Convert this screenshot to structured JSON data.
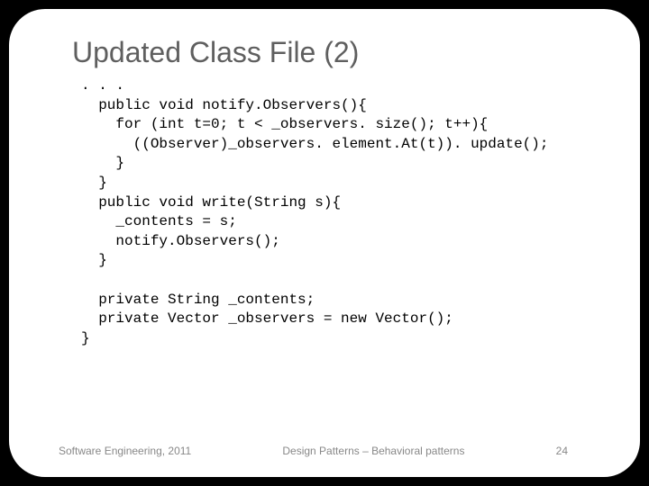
{
  "title": "Updated Class File (2)",
  "code": ". . .\n  public void notify.Observers(){\n    for (int t=0; t < _observers. size(); t++){\n      ((Observer)_observers. element.At(t)). update();\n    }\n  }\n  public void write(String s){\n    _contents = s;\n    notify.Observers();\n  }\n\n  private String _contents;\n  private Vector _observers = new Vector();\n}",
  "footer": {
    "left": "Software Engineering, 2011",
    "center": "Design Patterns – Behavioral patterns",
    "right": "24"
  }
}
